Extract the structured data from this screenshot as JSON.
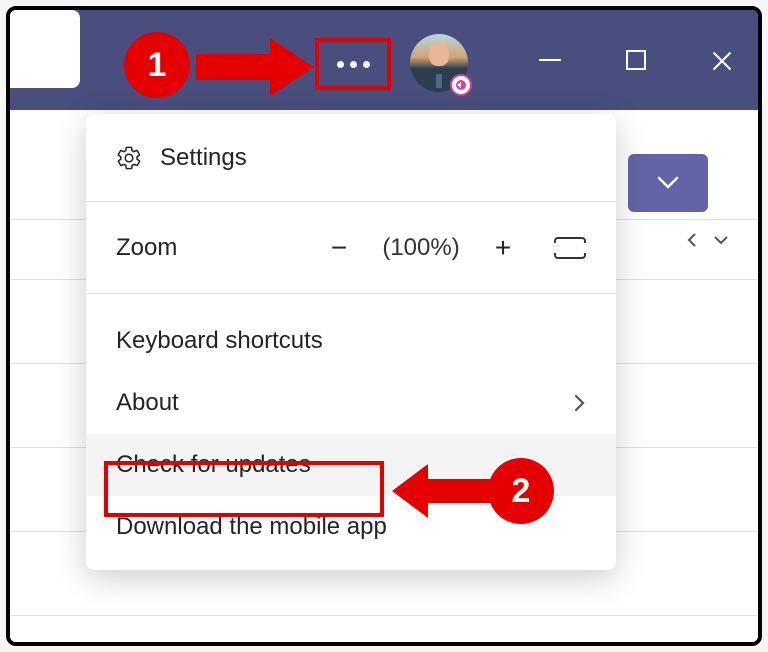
{
  "callouts": {
    "one": "1",
    "two": "2"
  },
  "menu": {
    "settings_label": "Settings",
    "zoom_label": "Zoom",
    "zoom_value": "(100%)",
    "items": {
      "keyboard_shortcuts": "Keyboard shortcuts",
      "about": "About",
      "check_for_updates": "Check for updates",
      "download_mobile": "Download the mobile app"
    }
  }
}
